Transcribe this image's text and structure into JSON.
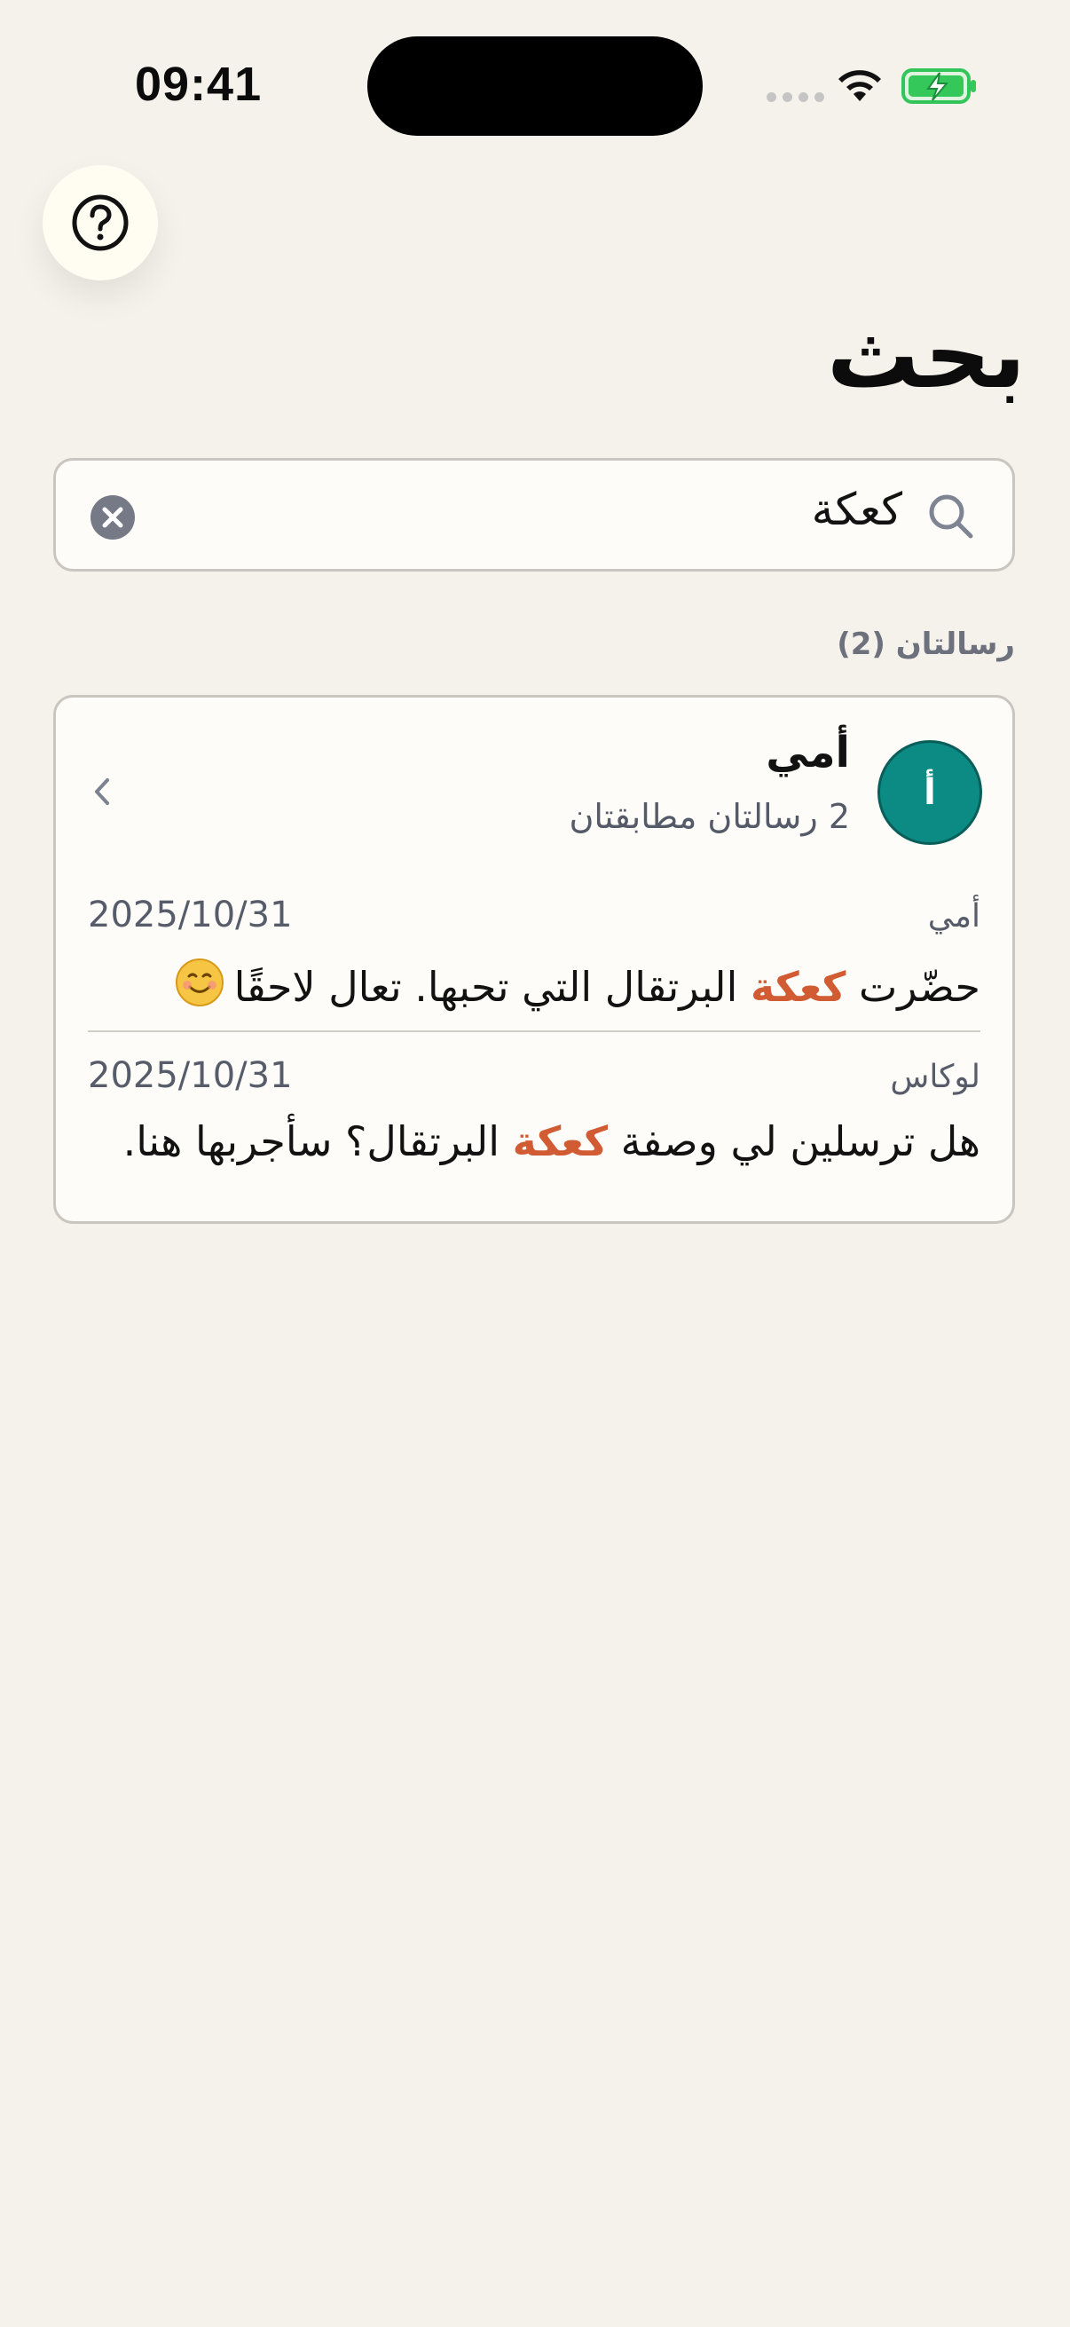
{
  "status_bar": {
    "time": "09:41"
  },
  "page": {
    "title": "بحث"
  },
  "search": {
    "value": "كعكة"
  },
  "results": {
    "count_label": "رسالتان (2)"
  },
  "card": {
    "avatar_initial": "أ",
    "contact_name": "أمي",
    "match_count": "2 رسالتان مطابقتان",
    "messages": [
      {
        "sender": "أمي",
        "date": "2025/10/31",
        "text_before": "حضّرت ",
        "highlight": "كعكة",
        "text_after": " البرتقال التي تحبها. تعال لاحقًا",
        "emoji": "☺️"
      },
      {
        "sender": "لوكاس",
        "date": "2025/10/31",
        "text_before": "هل ترسلين لي وصفة ",
        "highlight": "كعكة",
        "text_after": " البرتقال؟ سأجربها هنا.",
        "emoji": ""
      }
    ]
  },
  "colors": {
    "background": "#f5f2eb",
    "avatar": "#0b8b84",
    "highlight": "#d15c33",
    "muted_text": "#575c6a"
  },
  "icons": {
    "help": "question-mark-circle-icon",
    "search": "magnifier-icon",
    "clear": "clear-circle-x-icon",
    "chevron": "chevron-left-icon",
    "wifi": "wifi-icon",
    "battery": "battery-charging-icon"
  }
}
